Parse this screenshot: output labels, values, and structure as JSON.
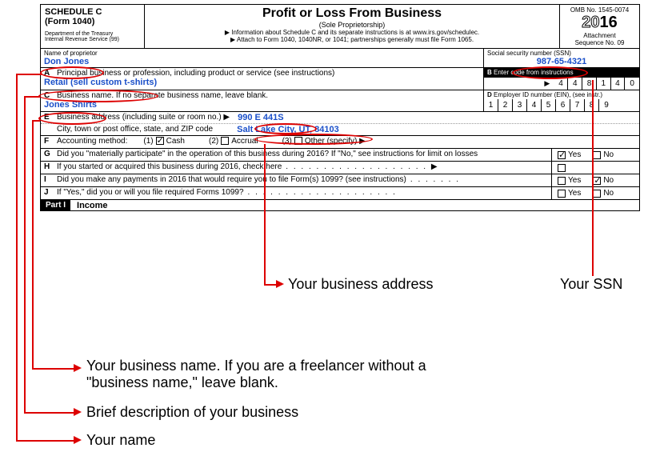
{
  "header": {
    "schedule": "SCHEDULE C",
    "form": "(Form 1040)",
    "dept": "Department of the Treasury",
    "irs": "Internal Revenue Service (99)",
    "title": "Profit or Loss From Business",
    "subtitle": "(Sole Proprietorship)",
    "info1": "▶ Information about Schedule C and its separate instructions is at www.irs.gov/schedulec.",
    "info2": "▶ Attach to Form 1040, 1040NR, or 1041; partnerships generally must file Form 1065.",
    "omb": "OMB No. 1545-0074",
    "year_prefix": "20",
    "year_suffix": "16",
    "attachment": "Attachment",
    "seqno": "Sequence No. 09"
  },
  "name_row": {
    "label": "Name of proprietor",
    "value": "Don Jones",
    "ssn_label": "Social security number (SSN)",
    "ssn": "987-65-4321"
  },
  "rowA": {
    "letter": "A",
    "label": "Principal business or profession, including product or service (see instructions)",
    "value": "Retail (sell custom t-shirts)",
    "right_letter": "B",
    "right_label": "Enter code from instructions",
    "code": [
      "4",
      "4",
      "8",
      "1",
      "4",
      "0"
    ]
  },
  "rowC": {
    "letter": "C",
    "label": "Business name. If no separate business name, leave blank.",
    "value": "Jones Shirts",
    "right_letter": "D",
    "right_label": "Employer ID number (EIN), (see instr.)",
    "ein": [
      "1",
      "2",
      "3",
      "4",
      "5",
      "6",
      "7",
      "8",
      "9"
    ]
  },
  "rowE": {
    "letter": "E",
    "label1": "Business address (including suite or room no.) ▶",
    "addr1": "990 E 441S",
    "label2": "City, town or post office, state, and ZIP code",
    "addr2": "Salt Lake City, UT, 84103"
  },
  "rowF": {
    "letter": "F",
    "label": "Accounting method:",
    "opt1": "(1)",
    "cash": "Cash",
    "opt2": "(2)",
    "accrual": "Accrual",
    "opt3": "(3)",
    "other": "Other (specify) ▶"
  },
  "rowG": {
    "letter": "G",
    "text": "Did you \"materially participate\" in the operation of this business during 2016? If \"No,\" see instructions for limit on losses",
    "yes": "Yes",
    "no": "No"
  },
  "rowH": {
    "letter": "H",
    "text": "If you started or acquired this business during 2016, check here",
    "dots": ". . . . . . . . . . . . . . . . . . . ▶"
  },
  "rowI": {
    "letter": "I",
    "text": "Did you make any payments in 2016 that would require you to file Form(s) 1099? (see instructions)",
    "dots": ". . . . . . .",
    "yes": "Yes",
    "no": "No"
  },
  "rowJ": {
    "letter": "J",
    "text": "If \"Yes,\" did you or will you file required Forms 1099?",
    "dots": ". . . . . . . . . . . . . . . . . . . .",
    "yes": "Yes",
    "no": "No"
  },
  "part1": {
    "label": "Part I",
    "title": "Income"
  },
  "annotations": {
    "ssn": "Your SSN",
    "addr": "Your business address",
    "bizname": "Your business name.  If you are a freelancer without a \"business name,\" leave blank.",
    "desc": "Brief description of your business",
    "name": "Your name"
  }
}
